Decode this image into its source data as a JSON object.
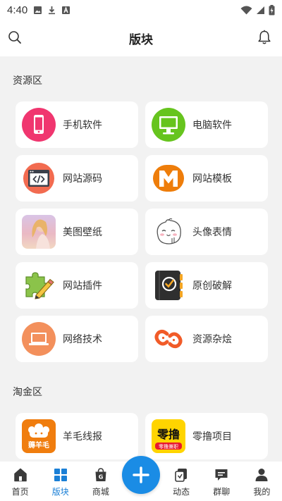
{
  "status_bar": {
    "time": "4:40"
  },
  "header": {
    "title": "版块"
  },
  "sections": [
    {
      "title": "资源区",
      "items": [
        {
          "label": "手机软件",
          "icon": "phone-icon"
        },
        {
          "label": "电脑软件",
          "icon": "monitor-icon"
        },
        {
          "label": "网站源码",
          "icon": "code-icon"
        },
        {
          "label": "网站模板",
          "icon": "template-m-icon"
        },
        {
          "label": "美图壁纸",
          "icon": "wallpaper-photo-icon"
        },
        {
          "label": "头像表情",
          "icon": "emoji-face-icon"
        },
        {
          "label": "网站插件",
          "icon": "plugin-puzzle-icon"
        },
        {
          "label": "原创破解",
          "icon": "notebook-check-icon"
        },
        {
          "label": "网络技术",
          "icon": "laptop-icon"
        },
        {
          "label": "资源杂烩",
          "icon": "chain-link-icon"
        }
      ]
    },
    {
      "title": "淘金区",
      "items": [
        {
          "label": "羊毛线报",
          "icon": "sheep-icon",
          "icon_text": "薅羊毛"
        },
        {
          "label": "零撸项目",
          "icon": "zero-project-icon",
          "icon_text": "零撸",
          "icon_subtext": "零撸兼职"
        }
      ]
    }
  ],
  "bottom_nav": [
    {
      "label": "首页",
      "icon": "home-icon"
    },
    {
      "label": "版块",
      "icon": "grid-icon",
      "active": true
    },
    {
      "label": "商城",
      "icon": "shopping-bag-icon"
    },
    {
      "label": "动态",
      "icon": "moments-icon"
    },
    {
      "label": "群聊",
      "icon": "chat-icon"
    },
    {
      "label": "我的",
      "icon": "user-icon"
    }
  ],
  "colors": {
    "accent": "#1a7fd6",
    "fab": "#1a8ce5",
    "background": "#f2f2f2"
  }
}
